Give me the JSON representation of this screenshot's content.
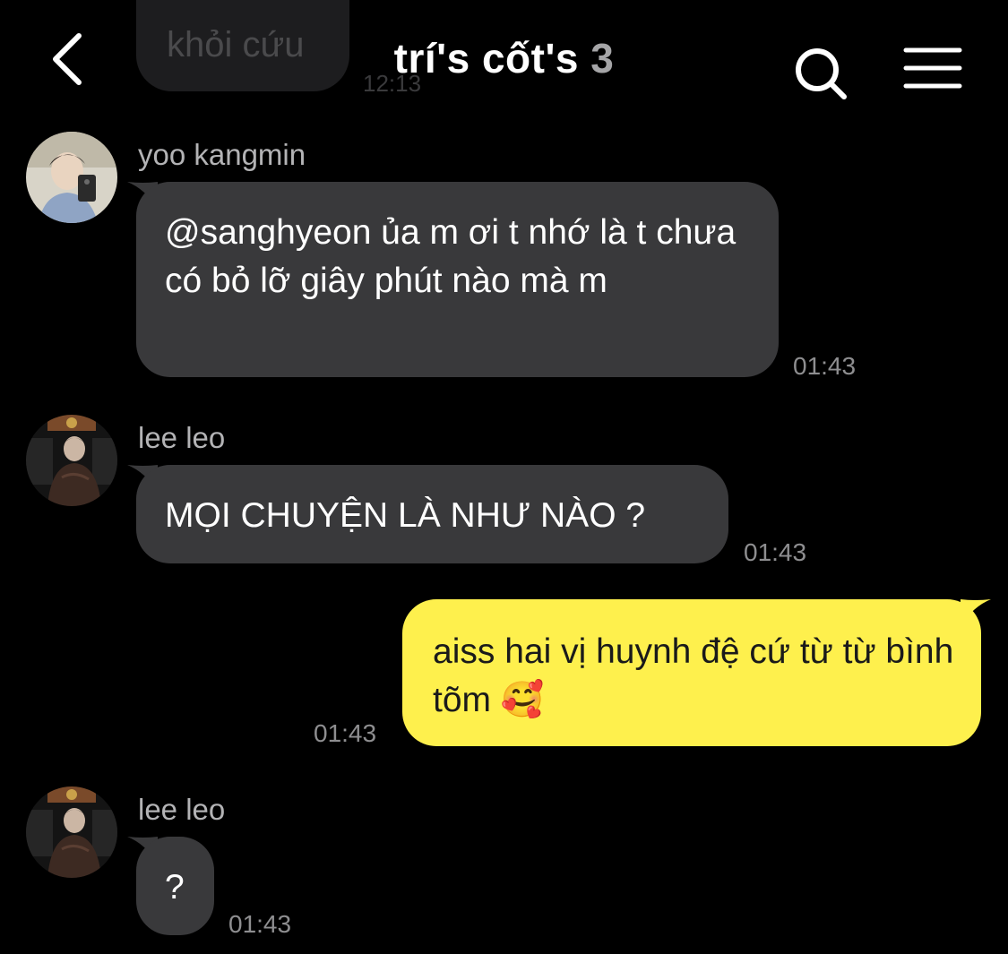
{
  "header": {
    "title": "trí's cốt's",
    "member_count": "3"
  },
  "previous_message": {
    "text": "khỏi cứu",
    "time": "12:13"
  },
  "messages": [
    {
      "sender": "yoo kangmin",
      "text": "@sanghyeon ủa m ơi t nhớ là t chưa có bỏ lỡ giây phút nào mà m",
      "time": "01:43",
      "avatar": "avatar-yoo-kangmin"
    },
    {
      "sender": "lee leo",
      "text": "MỌI CHUYỆN LÀ NHƯ NÀO ?",
      "time": "01:43",
      "avatar": "avatar-lee-leo"
    },
    {
      "sender": "me",
      "text": "aiss hai vị huynh đệ cứ từ từ bình tõm 🥰",
      "time": "01:43"
    },
    {
      "sender": "lee leo",
      "text": "?",
      "time": "01:43",
      "avatar": "avatar-lee-leo"
    }
  ],
  "colors": {
    "background": "#000000",
    "incoming_bubble": "#39393b",
    "outgoing_bubble": "#fef04d",
    "timestamp": "#8e8e90",
    "sender_name": "#b3b3b5"
  },
  "icons": {
    "back": "chevron-left-icon",
    "search": "search-icon",
    "menu": "hamburger-menu-icon"
  }
}
